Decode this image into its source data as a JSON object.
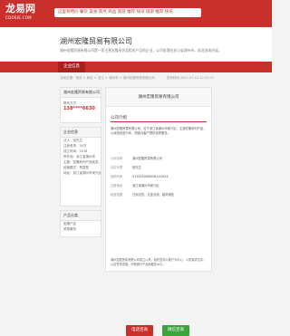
{
  "site": {
    "logo_main": "龙易网",
    "logo_sub": "CDOSIE.COM",
    "search_text": "这里有特价 餐饮 美食 景点 商品 旅游 推荐 快讯 旅游 推荐 快讯"
  },
  "company": {
    "name": "湖州宏隆贸易有限公司",
    "desc": "湖州宏隆贸易有限公司是一家主营宏隆系列及相关产品的企业，公司坐落在浙江省湖州市，欢迎咨询洽谈。",
    "sidebar_name": "湖州宏隆贸易有限公司"
  },
  "nav": {
    "home": "企业信息"
  },
  "breadcrumb": {
    "path": "当前位置：首页 > 黄页 > 浙江 > 湖州市 > 湖州宏隆贸易有限公司",
    "update": "发布时间 2021-07-14 12:57:07"
  },
  "sidebar": {
    "contact_title": "联系方式",
    "phone": "138****6630",
    "info_title": "企业信息",
    "info_lines": [
      "法人：张先生",
      "注册资本：50万",
      "成立时间：2016",
      "所在地：浙江省湖州市",
      "主营：宏隆系列产品批发、零售及相关服务",
      "经营模式：贸易型",
      "地址：浙江省湖州市吴兴区"
    ],
    "product_title": "产品分类",
    "product_lines": [
      "宏隆产品",
      "贸易服务"
    ]
  },
  "main": {
    "banner_title": "湖州宏隆贸易有限公司",
    "section_title": "公司介绍",
    "intro": "湖州宏隆贸易有限公司，位于浙江省湖州市吴兴区，主营宏隆系列产品，以诚信经营为本，竭诚为客户提供优质服务。",
    "fields": [
      {
        "k": "公司名称",
        "v": "湖州宏隆贸易有限公司"
      },
      {
        "k": "法定代表",
        "v": "张先生"
      },
      {
        "k": "信用代码",
        "v": "91330500MA2B1XXXXX"
      },
      {
        "k": "注册地址",
        "v": "浙江省湖州市吴兴区"
      },
      {
        "k": "经营范围",
        "v": "日用百货、五金交电、建材销售"
      }
    ],
    "body": "湖州宏隆贸易有限公司成立以来，始终坚持以客户为中心，以质量求生存，以信誉求发展，不断提升产品和服务水平。",
    "btn_call": "电话咨询",
    "btn_wechat": "微信咨询"
  },
  "colors": {
    "brand": "#c9302c",
    "green": "#3aa53a"
  }
}
